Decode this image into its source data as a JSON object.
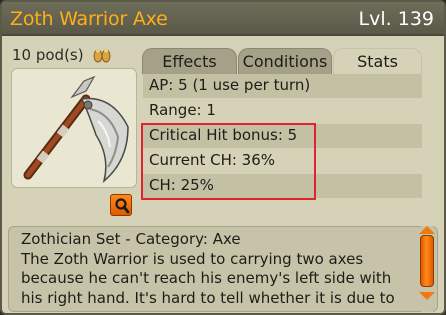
{
  "item": {
    "name": "Zoth Warrior Axe",
    "level": "Lvl. 139",
    "pods": "10 pod(s)",
    "image_icon": "axe-icon",
    "zoom_icon": "magnifier-icon"
  },
  "tabs": [
    {
      "label": "Effects",
      "active": false
    },
    {
      "label": "Conditions",
      "active": false
    },
    {
      "label": "Stats",
      "active": true
    }
  ],
  "stats": [
    "AP: 5 (1 use per turn)",
    "Range: 1",
    "Critical Hit bonus: 5",
    "Current CH: 36%",
    "CH: 25%"
  ],
  "description": {
    "lines": [
      "Zothician Set - Category: Axe",
      "The Zoth Warrior is used to carrying two axes",
      "because he can't reach his enemy's left side with",
      "his right hand. It's hard to tell whether it is due to"
    ]
  },
  "colors": {
    "title_text": "#ffae1a",
    "highlight": "#e0242f",
    "scroll_accent": "#f07a10"
  }
}
